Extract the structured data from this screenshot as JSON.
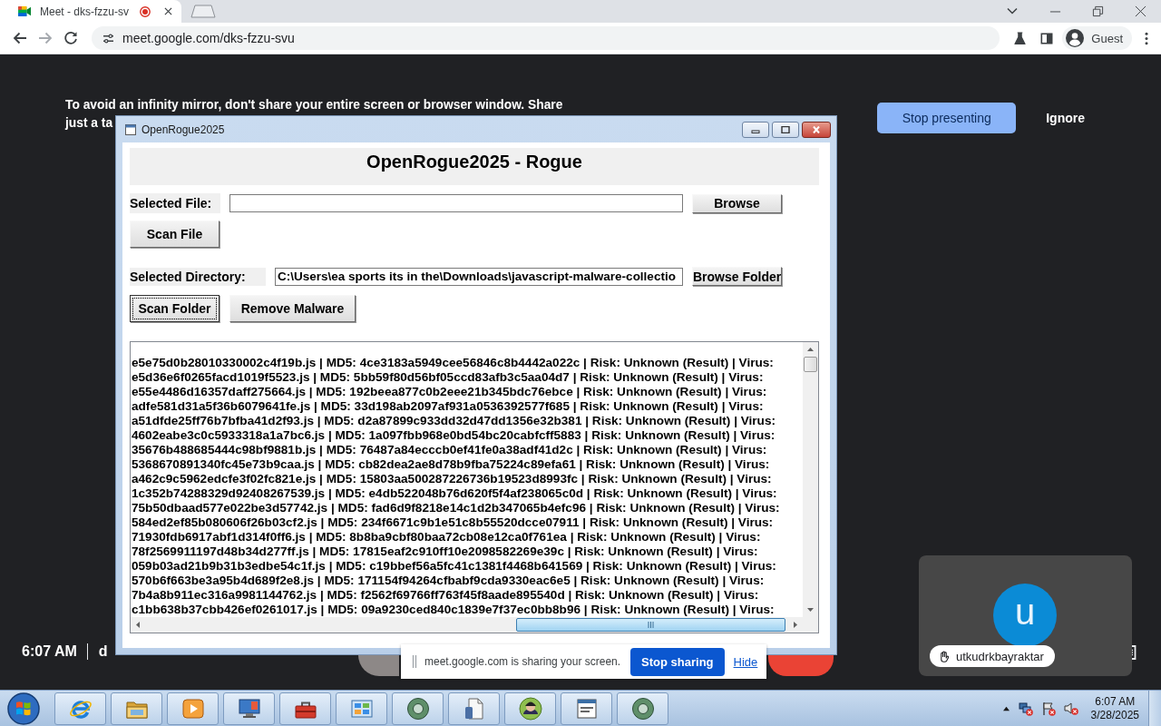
{
  "browser": {
    "tab": {
      "title": "Meet - dks-fzzu-sv",
      "selected": true,
      "recording": true
    },
    "navigation": {
      "back_disabled": false,
      "forward_disabled": true
    },
    "address": "meet.google.com/dks-fzzu-svu",
    "profile": "Guest"
  },
  "meet": {
    "notice_lines": [
      "To avoid an infinity mirror, don't share your entire screen or browser window. Share",
      "just a ta"
    ],
    "actions": [
      {
        "label": "Stop presenting",
        "kind": "primary"
      },
      {
        "label": "Ignore",
        "kind": "text"
      }
    ],
    "time": "6:07 AM",
    "meeting_code": "d",
    "participant": {
      "initial": "u",
      "name": "utkudrkbayraktar"
    },
    "share_bar": {
      "message": "meet.google.com is sharing your screen.",
      "stop_button": "Stop sharing",
      "hide_link": "Hide"
    }
  },
  "app_window": {
    "title": "OpenRogue2025",
    "heading": "OpenRogue2025 - Rogue",
    "file": {
      "label": "Selected File:",
      "button": {
        "label": "Browse",
        "focused": false
      }
    },
    "file_actions": [
      {
        "label": "Scan File",
        "focused": false
      }
    ],
    "directory": {
      "label": "Selected Directory:",
      "value": "C:\\Users\\ea sports its in the\\Downloads\\javascript-malware-collectio",
      "button": {
        "label": "Browse Folder",
        "focused": false
      }
    },
    "directory_actions": [
      {
        "label": "Scan Folder",
        "focused": true
      },
      {
        "label": "Remove Malware",
        "focused": false
      }
    ],
    "results": [
      "e5e75d0b28010330002c4f19b.js | MD5: 4ce3183a5949cee56846c8b4442a022c | Risk: Unknown (Result) | Virus:",
      "e5d36e6f0265facd1019f5523.js | MD5: 5bb59f80d56bf05ccd83afb3c5aa04d7 | Risk: Unknown (Result) | Virus:",
      "e55e4486d16357daff275664.js | MD5: 192beea877c0b2eee21b345bdc76ebce | Risk: Unknown (Result) | Virus:",
      "adfe581d31a5f36b6079641fe.js | MD5: 33d198ab2097af931a0536392577f685 | Risk: Unknown (Result) | Virus:",
      "a51dfde25ff76b7bfba41d2f93.js | MD5: d2a87899c933dd32d47dd1356e32b381 | Risk: Unknown (Result) | Virus:",
      "4602eabe3c0c5933318a1a7bc6.js | MD5: 1a097fbb968e0bd54bc20cabfcff5883 | Risk: Unknown (Result) | Virus:",
      "35676b488685444c98bf9881b.js | MD5: 76487a84ecccb0ef41fe0a38adf41d2c | Risk: Unknown (Result) | Virus:",
      "5368670891340fc45e73b9caa.js | MD5: cb82dea2ae8d78b9fba75224c89efa61 | Risk: Unknown (Result) | Virus:",
      "a462c9c5962edcfe3f02fc821e.js | MD5: 15803aa500287226736b19523d8993fc | Risk: Unknown (Result) | Virus:",
      "1c352b74288329d92408267539.js | MD5: e4db522048b76d620f5f4af238065c0d | Risk: Unknown (Result) | Virus:",
      "75b50dbaad577e022be3d57742.js | MD5: fad6d9f8218e14c1d2b347065b4efc96 | Risk: Unknown (Result) | Virus:",
      "584ed2ef85b080606f26b03cf2.js | MD5: 234f6671c9b1e51c8b55520dcce07911 | Risk: Unknown (Result) | Virus:",
      "71930fdb6917abf1d314f0ff6.js | MD5: 8b8ba9cbf80baa72cb08e12ca0f761ea | Risk: Unknown (Result) | Virus:",
      "78f2569911197d48b34d277ff.js | MD5: 17815eaf2c910ff10e2098582269e39c | Risk: Unknown (Result) | Virus:",
      "059b03ad21b9b31b3edbe54c1f.js | MD5: c19bbef56a5fc41c1381f4468b641569 | Risk: Unknown (Result) | Virus:",
      "570b6f663be3a95b4d689f2e8.js | MD5: 171154f94264cfbabf9cda9330eac6e5 | Risk: Unknown (Result) | Virus:",
      "7b4a8b911ec316a9981144762.js | MD5: f2562f69766ff763f45f8aade895540d | Risk: Unknown (Result) | Virus:",
      "c1bb638b37cbb426ef0261017.js | MD5: 09a9230ced840c1839e7f37ec0bb8b96 | Risk: Unknown (Result) | Virus:"
    ]
  },
  "taskbar": {
    "clock": {
      "time": "6:07 AM",
      "date": "3/28/2025"
    }
  }
}
